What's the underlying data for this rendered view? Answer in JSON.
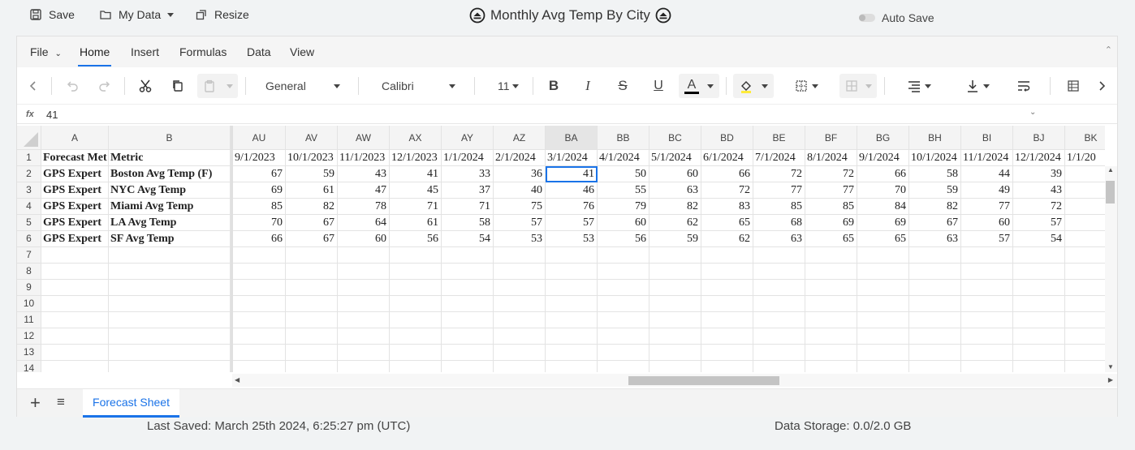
{
  "topbar": {
    "save_label": "Save",
    "mydata_label": "My Data",
    "resize_label": "Resize",
    "title": "Monthly Avg Temp By City",
    "autosave_label": "Auto Save"
  },
  "menu": {
    "tabs": [
      "File",
      "Home",
      "Insert",
      "Formulas",
      "Data",
      "View"
    ],
    "active": "Home"
  },
  "ribbon": {
    "number_format": "General",
    "font_name": "Calibri",
    "font_size": "11",
    "font_color": "#000000",
    "fill_color": "#ffeb3b"
  },
  "formula_bar": {
    "fx_label": "fx",
    "value": "41"
  },
  "columns": [
    "A",
    "B",
    "AU",
    "AV",
    "AW",
    "AX",
    "AY",
    "AZ",
    "BA",
    "BB",
    "BC",
    "BD",
    "BE",
    "BF",
    "BG",
    "BH",
    "BI",
    "BJ",
    "BK"
  ],
  "selected_column": "BA",
  "header_row": [
    "Forecast Met",
    "Metric",
    "9/1/2023",
    "10/1/2023",
    "11/1/2023",
    "12/1/2023",
    "1/1/2024",
    "2/1/2024",
    "3/1/2024",
    "4/1/2024",
    "5/1/2024",
    "6/1/2024",
    "7/1/2024",
    "8/1/2024",
    "9/1/2024",
    "10/1/2024",
    "11/1/2024",
    "12/1/2024",
    "1/1/20"
  ],
  "rows": [
    {
      "a": "GPS Expert",
      "b": "Boston Avg Temp (F)",
      "values": [
        "67",
        "59",
        "43",
        "41",
        "33",
        "36",
        "41",
        "50",
        "60",
        "66",
        "72",
        "72",
        "66",
        "58",
        "44",
        "39"
      ]
    },
    {
      "a": "GPS Expert",
      "b": "NYC Avg Temp",
      "values": [
        "69",
        "61",
        "47",
        "45",
        "37",
        "40",
        "46",
        "55",
        "63",
        "72",
        "77",
        "77",
        "70",
        "59",
        "49",
        "43"
      ]
    },
    {
      "a": "GPS Expert",
      "b": "Miami Avg Temp",
      "values": [
        "85",
        "82",
        "78",
        "71",
        "71",
        "75",
        "76",
        "79",
        "82",
        "83",
        "85",
        "85",
        "84",
        "82",
        "77",
        "72"
      ]
    },
    {
      "a": "GPS Expert",
      "b": "LA Avg Temp",
      "values": [
        "70",
        "67",
        "64",
        "61",
        "58",
        "57",
        "57",
        "60",
        "62",
        "65",
        "68",
        "69",
        "69",
        "67",
        "60",
        "57"
      ]
    },
    {
      "a": "GPS Expert",
      "b": "SF Avg Temp",
      "values": [
        "66",
        "67",
        "60",
        "56",
        "54",
        "53",
        "53",
        "56",
        "59",
        "62",
        "63",
        "65",
        "65",
        "63",
        "57",
        "54"
      ]
    }
  ],
  "row_numbers": [
    "1",
    "2",
    "3",
    "4",
    "5",
    "6",
    "7",
    "8",
    "9",
    "10",
    "11",
    "12",
    "13",
    "14"
  ],
  "sheets": [
    "Forecast Sheet"
  ],
  "footer": {
    "last_saved": "Last Saved: March 25th 2024, 6:25:27 pm (UTC)",
    "storage": "Data Storage: 0.0/2.0 GB"
  }
}
